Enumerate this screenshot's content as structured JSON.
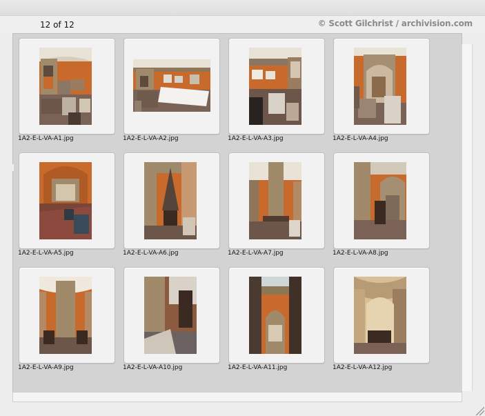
{
  "header": {
    "count_text": "12 of 12",
    "copyright": "© Scott Gilchrist / archivision.com"
  },
  "thumbnails": [
    {
      "filename": "1A2-E-L-VA-A1.jpg",
      "icon": "museum-gallery-photo"
    },
    {
      "filename": "1A2-E-L-VA-A2.jpg",
      "icon": "museum-gallery-photo"
    },
    {
      "filename": "1A2-E-L-VA-A3.jpg",
      "icon": "museum-gallery-photo"
    },
    {
      "filename": "1A2-E-L-VA-A4.jpg",
      "icon": "museum-gallery-photo"
    },
    {
      "filename": "1A2-E-L-VA-A5.jpg",
      "icon": "museum-gallery-photo"
    },
    {
      "filename": "1A2-E-L-VA-A6.jpg",
      "icon": "museum-gallery-photo"
    },
    {
      "filename": "1A2-E-L-VA-A7.jpg",
      "icon": "museum-gallery-photo"
    },
    {
      "filename": "1A2-E-L-VA-A8.jpg",
      "icon": "museum-gallery-photo"
    },
    {
      "filename": "1A2-E-L-VA-A9.jpg",
      "icon": "museum-gallery-photo"
    },
    {
      "filename": "1A2-E-L-VA-A10.jpg",
      "icon": "museum-gallery-photo"
    },
    {
      "filename": "1A2-E-L-VA-A11.jpg",
      "icon": "museum-gallery-photo"
    },
    {
      "filename": "1A2-E-L-VA-A12.jpg",
      "icon": "museum-gallery-photo"
    }
  ],
  "colors": {
    "wall": "#c86a2c",
    "stone": "#a08a69",
    "floor": "#7a6257",
    "dark": "#3a2a22",
    "ceiling": "#e9e3d7"
  }
}
